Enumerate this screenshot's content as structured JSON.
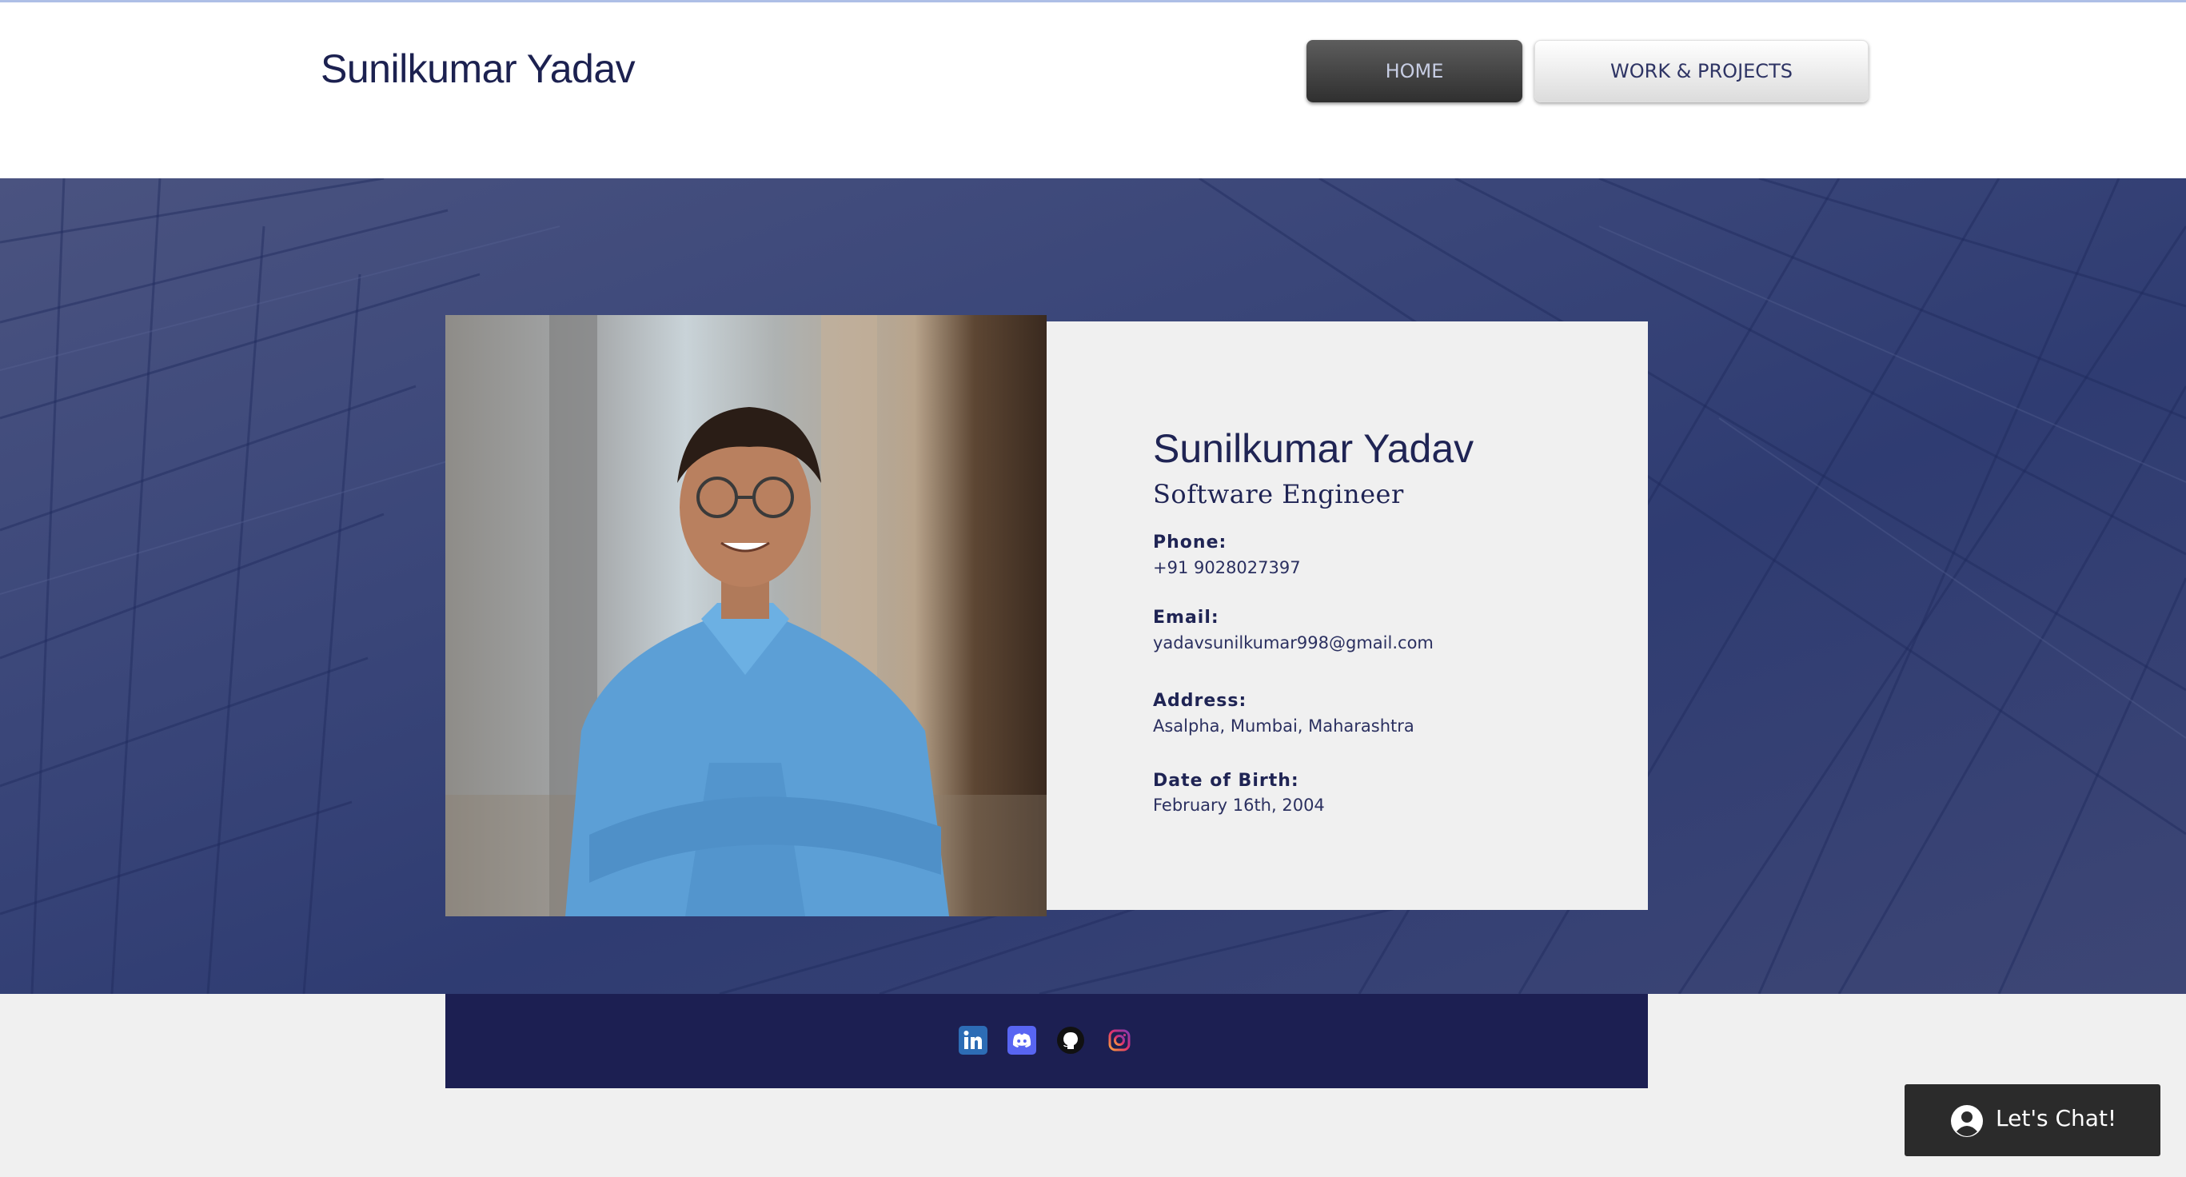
{
  "header": {
    "site_title": "Sunilkumar Yadav",
    "nav": {
      "home_label": "HOME",
      "work_label": "WORK & PROJECTS"
    }
  },
  "profile": {
    "name": "Sunilkumar Yadav",
    "role": "Software Engineer",
    "phone_label": "Phone:",
    "phone": "+91 9028027397",
    "email_label": "Email:",
    "email": "yadavsunilkumar998@gmail.com",
    "address_label": "Address:",
    "address": "Asalpha, Mumbai, Maharashtra",
    "dob_label": "Date of Birth:",
    "dob": "February 16th, 2004"
  },
  "social": [
    {
      "icon": "linkedin-icon",
      "color": "#2d6cb5"
    },
    {
      "icon": "discord-icon",
      "color": "#5865f2"
    },
    {
      "icon": "github-icon",
      "color": "#111111"
    },
    {
      "icon": "instagram-icon",
      "color": "#c13584"
    }
  ],
  "chat": {
    "label": "Let's Chat!"
  },
  "colors": {
    "brand_navy": "#1c1f52",
    "hero_blue": "#3a4679",
    "nav_active": "#3b3b3b"
  }
}
